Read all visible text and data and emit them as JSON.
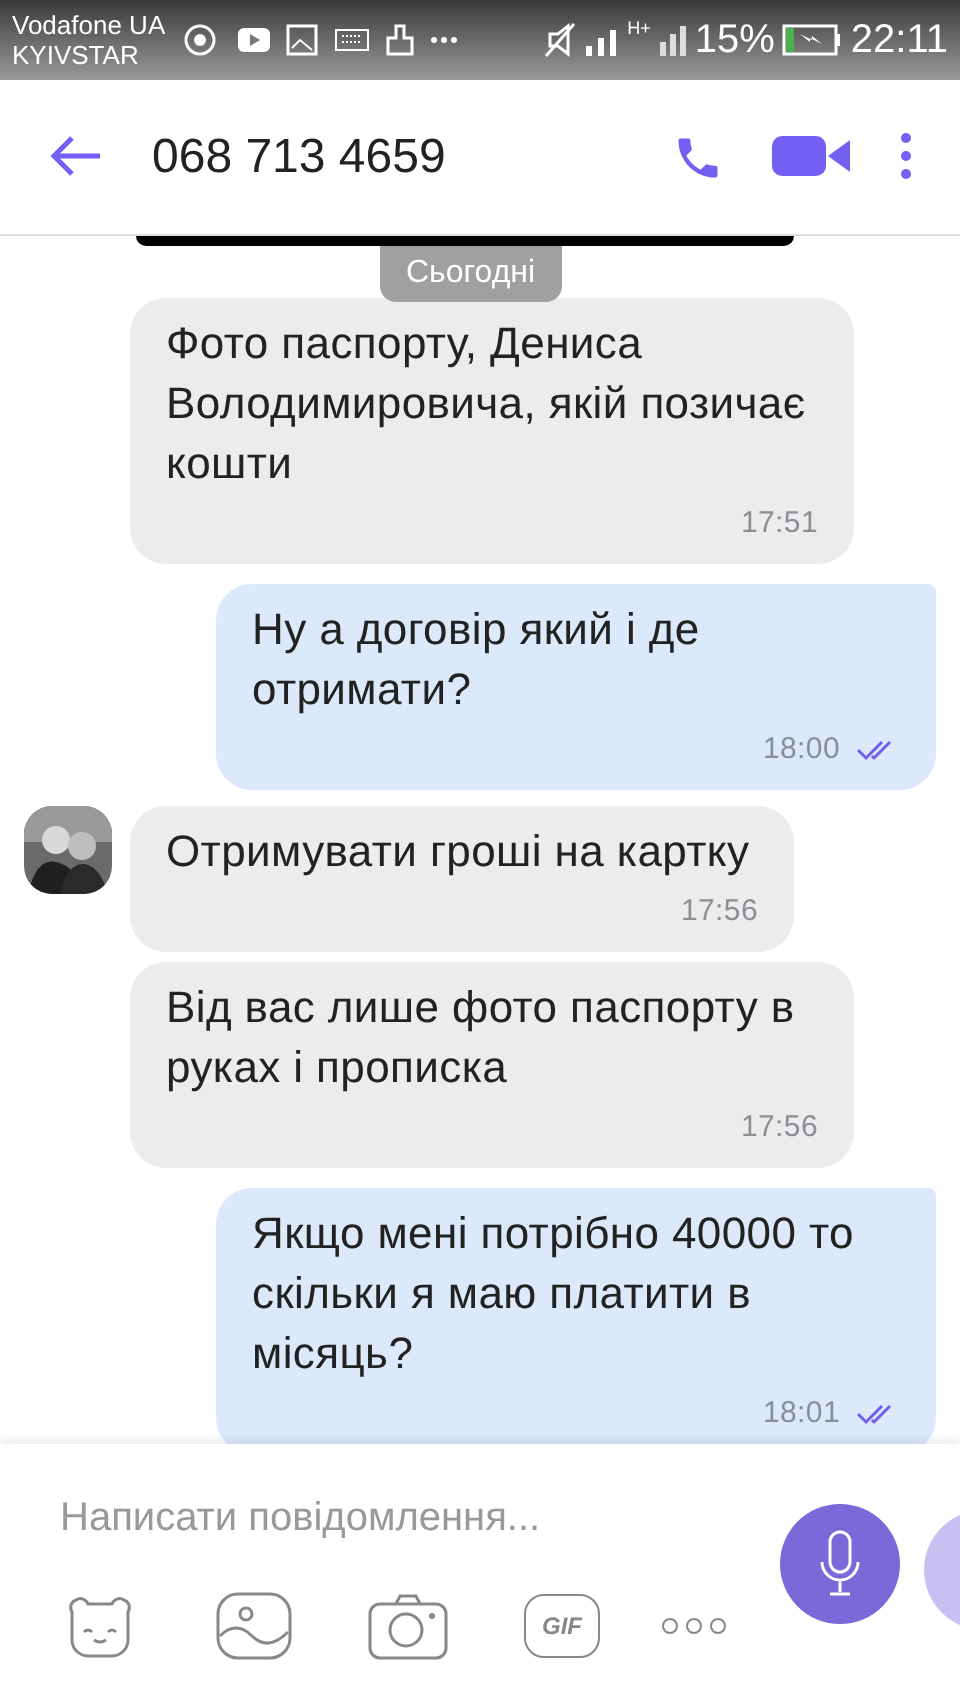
{
  "status_bar": {
    "carrier_1": "Vodafone UA",
    "carrier_2": "KYIVSTAR",
    "network_type": "H+",
    "battery": "15%",
    "time": "22:11"
  },
  "header": {
    "title": "068 713 4659"
  },
  "date_separator": "Сьогодні",
  "messages": [
    {
      "kind": "incoming",
      "avatar": false,
      "text": "Фото паспорту, Дениса Володимировича, якій позичає кошти",
      "time": "17:51"
    },
    {
      "kind": "outgoing",
      "read": true,
      "text": "Ну а договір який і де отримати?",
      "time": "18:00"
    },
    {
      "kind": "incoming",
      "avatar": true,
      "text": "Отримувати гроші на картку",
      "time": "17:56"
    },
    {
      "kind": "incoming",
      "avatar": false,
      "text": "Від вас лише фото паспорту в руках і прописка",
      "time": "17:56"
    },
    {
      "kind": "outgoing",
      "read": true,
      "text": "Якщо мені потрібно 40000 то скільки я маю платити в місяць?",
      "time": "18:01"
    }
  ],
  "composer": {
    "placeholder": "Написати повідомлення...",
    "gif_label": "GIF"
  }
}
